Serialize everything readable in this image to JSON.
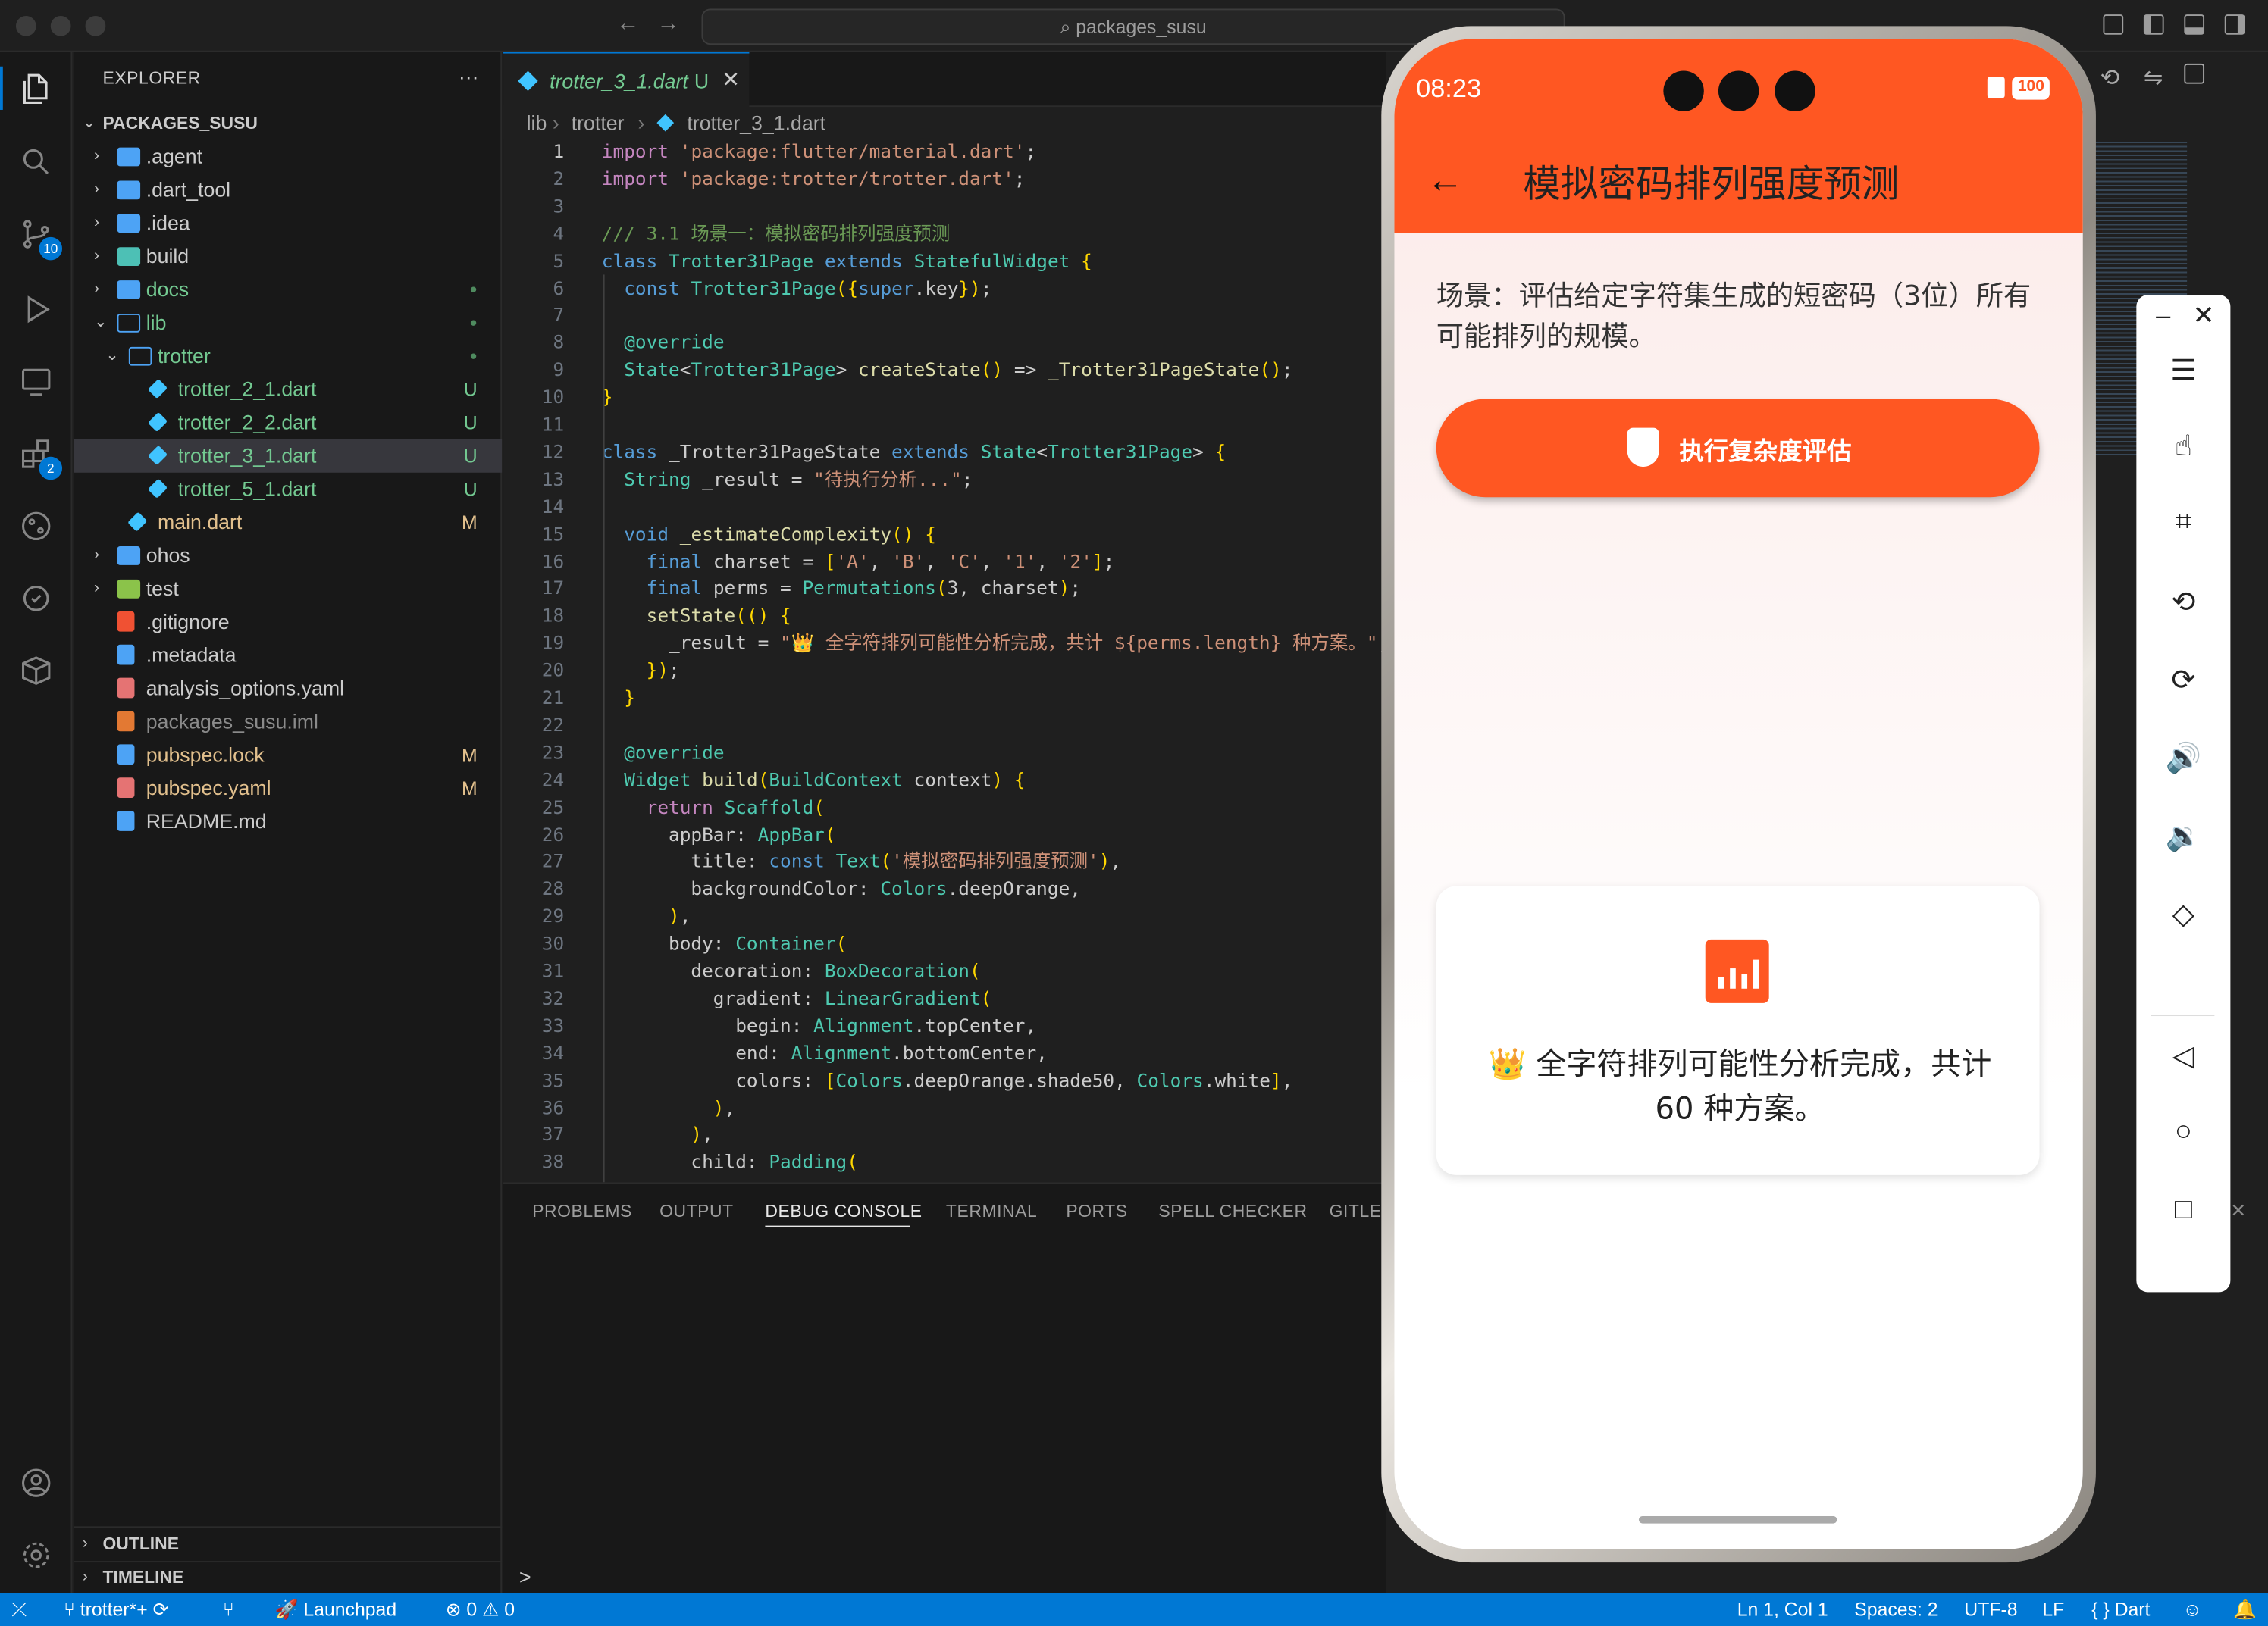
{
  "titlebar": {
    "search_text": "packages_susu"
  },
  "activity": {
    "scm_badge": "10",
    "ext_badge": "2"
  },
  "explorer": {
    "header": "EXPLORER",
    "more": "···",
    "root": "PACKAGES_SUSU",
    "items": [
      {
        "label": "agent",
        "display": ".agent",
        "status": ""
      },
      {
        "display": ".dart_tool",
        "status": ""
      },
      {
        "display": ".idea",
        "status": ""
      },
      {
        "display": "build",
        "status": ""
      },
      {
        "display": "docs",
        "status": "●"
      },
      {
        "display": "lib",
        "status": "●"
      },
      {
        "display": "trotter",
        "status": "●"
      },
      {
        "display": "trotter_2_1.dart",
        "status": "U"
      },
      {
        "display": "trotter_2_2.dart",
        "status": "U"
      },
      {
        "display": "trotter_3_1.dart",
        "status": "U"
      },
      {
        "display": "trotter_5_1.dart",
        "status": "U"
      },
      {
        "display": "main.dart",
        "status": "M"
      },
      {
        "display": "ohos",
        "status": ""
      },
      {
        "display": "test",
        "status": ""
      },
      {
        "display": ".gitignore",
        "status": ""
      },
      {
        "display": ".metadata",
        "status": ""
      },
      {
        "display": "analysis_options.yaml",
        "status": ""
      },
      {
        "display": "packages_susu.iml",
        "status": ""
      },
      {
        "display": "pubspec.lock",
        "status": "M"
      },
      {
        "display": "pubspec.yaml",
        "status": "M"
      },
      {
        "display": "README.md",
        "status": ""
      }
    ],
    "outline": "OUTLINE",
    "timeline": "TIMELINE"
  },
  "editor": {
    "tab_label": "trotter_3_1.dart",
    "tab_status": "U",
    "breadcrumb": [
      "lib",
      "trotter",
      "trotter_3_1.dart"
    ],
    "line_numbers": [
      "1",
      "2",
      "3",
      "4",
      "5",
      "6",
      "7",
      "8",
      "9",
      "10",
      "11",
      "12",
      "13",
      "14",
      "15",
      "16",
      "17",
      "18",
      "19",
      "20",
      "21",
      "22",
      "23",
      "24",
      "25",
      "26",
      "27",
      "28",
      "29",
      "30",
      "31",
      "32",
      "33",
      "34",
      "35",
      "36",
      "37",
      "38"
    ],
    "code": [
      "import 'package:flutter/material.dart';",
      "import 'package:trotter/trotter.dart';",
      "",
      "/// 3.1 场景一：模拟密码排列强度预测",
      "class Trotter31Page extends StatefulWidget {",
      "  const Trotter31Page({super.key});",
      "",
      "  @override",
      "  State<Trotter31Page> createState() => _Trotter31PageState();",
      "}",
      "",
      "class _Trotter31PageState extends State<Trotter31Page> {",
      "  String _result = \"待执行分析...\";",
      "",
      "  void _estimateComplexity() {",
      "    final charset = ['A', 'B', 'C', '1', '2'];",
      "    final perms = Permutations(3, charset);",
      "    setState(() {",
      "      _result = \"👑 全字符排列可能性分析完成，共计 ${perms.length} 种方案。\";",
      "    });",
      "  }",
      "",
      "  @override",
      "  Widget build(BuildContext context) {",
      "    return Scaffold(",
      "      appBar: AppBar(",
      "        title: const Text('模拟密码排列强度预测'),",
      "        backgroundColor: Colors.deepOrange,",
      "      ),",
      "      body: Container(",
      "        decoration: BoxDecoration(",
      "          gradient: LinearGradient(",
      "            begin: Alignment.topCenter,",
      "            end: Alignment.bottomCenter,",
      "            colors: [Colors.deepOrange.shade50, Colors.white],",
      "          ),",
      "        ),",
      "        child: Padding("
    ]
  },
  "panel": {
    "tabs": [
      "PROBLEMS",
      "OUTPUT",
      "DEBUG CONSOLE",
      "TERMINAL",
      "PORTS",
      "SPELL CHECKER",
      "GITLEN"
    ],
    "active": "DEBUG CONSOLE",
    "prompt": ">"
  },
  "statusbar": {
    "branch": "trotter*+",
    "launchpad": "Launchpad",
    "errors": "0",
    "warnings": "0",
    "position": "Ln 1, Col 1",
    "spaces": "Spaces: 2",
    "encoding": "UTF-8",
    "eol": "LF",
    "language": "Dart"
  },
  "phone": {
    "time": "08:23",
    "battery": "100",
    "app_title": "模拟密码排列强度预测",
    "scenario": "场景：评估给定字符集生成的短密码（3位）所有可能排列的规模。",
    "button_label": "执行复杂度评估",
    "result_text": "👑 全字符排列可能性分析完成，共计 60 种方案。"
  },
  "colors": {
    "accent": "#0078d4",
    "deep_orange": "#ff5722",
    "git_untracked": "#73c991",
    "git_modified": "#e2c08d"
  }
}
